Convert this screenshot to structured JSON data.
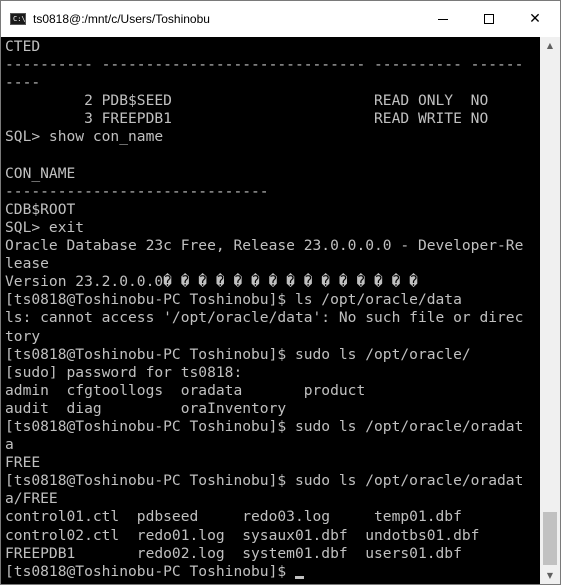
{
  "window": {
    "title": "ts0818@:/mnt/c/Users/Toshinobu",
    "icon": "terminal-icon",
    "app_icon_text": "C:\\"
  },
  "controls": {
    "minimize_icon": "minimize-icon",
    "maximize_icon": "maximize-icon",
    "close_glyph": "✕"
  },
  "colors": {
    "console_bg": "#000000",
    "console_fg": "#c0c0c0",
    "titlebar_bg": "#ffffff"
  },
  "terminal": {
    "lines": [
      "CTED",
      "---------- ------------------------------ ---------- ------",
      "----",
      "         2 PDB$SEED                       READ ONLY  NO",
      "         3 FREEPDB1                       READ WRITE NO",
      "SQL> show con_name",
      "",
      "CON_NAME",
      "------------------------------",
      "CDB$ROOT",
      "SQL> exit",
      "Oracle Database 23c Free, Release 23.0.0.0.0 - Developer-Re",
      "lease",
      "Version 23.2.0.0.0� � � � � � � � � � � � � � �",
      "[ts0818@Toshinobu-PC Toshinobu]$ ls /opt/oracle/data",
      "ls: cannot access '/opt/oracle/data': No such file or direc",
      "tory",
      "[ts0818@Toshinobu-PC Toshinobu]$ sudo ls /opt/oracle/",
      "[sudo] password for ts0818:",
      "admin  cfgtoollogs  oradata       product",
      "audit  diag         oraInventory",
      "[ts0818@Toshinobu-PC Toshinobu]$ sudo ls /opt/oracle/oradat",
      "a",
      "FREE",
      "[ts0818@Toshinobu-PC Toshinobu]$ sudo ls /opt/oracle/oradat",
      "a/FREE",
      "control01.ctl  pdbseed     redo03.log     temp01.dbf",
      "control02.ctl  redo01.log  sysaux01.dbf  undotbs01.dbf",
      "FREEPDB1       redo02.log  system01.dbf  users01.dbf"
    ],
    "prompt": "[ts0818@Toshinobu-PC Toshinobu]$ "
  },
  "scrollbar": {
    "up_glyph": "▲",
    "down_glyph": "▼",
    "position_fraction": 0.97
  }
}
